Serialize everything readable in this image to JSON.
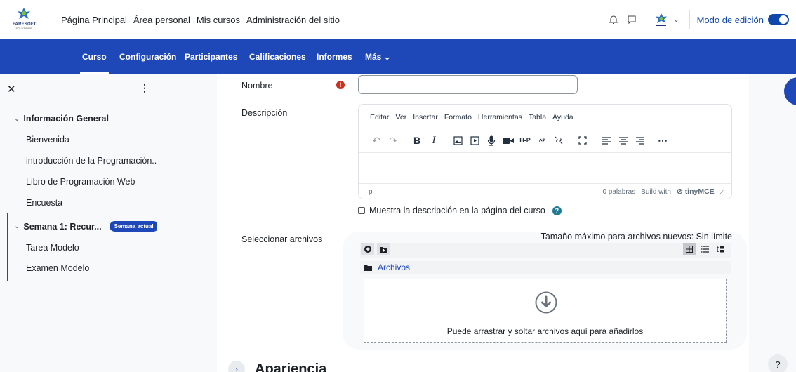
{
  "brand": {
    "logo_text": "FARESOFT",
    "logo_sub": "SOLUTIONS"
  },
  "topnav": {
    "items": [
      "Página Principal",
      "Área personal",
      "Mis cursos",
      "Administración del sitio"
    ],
    "edit_mode_label": "Modo de edición",
    "edit_mode_on": true
  },
  "secnav": {
    "items": [
      "Curso",
      "Configuración",
      "Participantes",
      "Calificaciones",
      "Informes",
      "Más ⌄"
    ],
    "active": "Curso"
  },
  "drawer": {
    "sections": [
      {
        "label": "Información General",
        "links": [
          "Bienvenida",
          "introducción de la Programación...",
          "Libro de Programación Web",
          "Encuesta"
        ]
      },
      {
        "label": "Semana 1: Recur...",
        "badge": "Semana actual",
        "links": [
          "Tarea Modelo",
          "Examen Modelo"
        ]
      }
    ]
  },
  "form": {
    "name_label": "Nombre",
    "name_value": "",
    "description_label": "Descripción",
    "editor": {
      "menu": [
        "Editar",
        "Ver",
        "Insertar",
        "Formato",
        "Herramientas",
        "Tabla",
        "Ayuda"
      ],
      "path": "p",
      "word_count": "0 palabras",
      "build_with": "Build with",
      "tiny_brand": "tinyMCE"
    },
    "show_description_label": "Muestra la descripción en la página del curso",
    "files_label": "Seleccionar archivos",
    "max_size": "Tamaño máximo para archivos nuevos: Sin límite",
    "folder_name": "Archivos",
    "drop_message": "Puede arrastrar y soltar archivos aquí para añadirlos",
    "appearance_title": "Apariencia"
  },
  "help_float": "?",
  "colors": {
    "primary": "#1e48b8",
    "danger": "#ca3120",
    "info": "#1f7a96"
  }
}
